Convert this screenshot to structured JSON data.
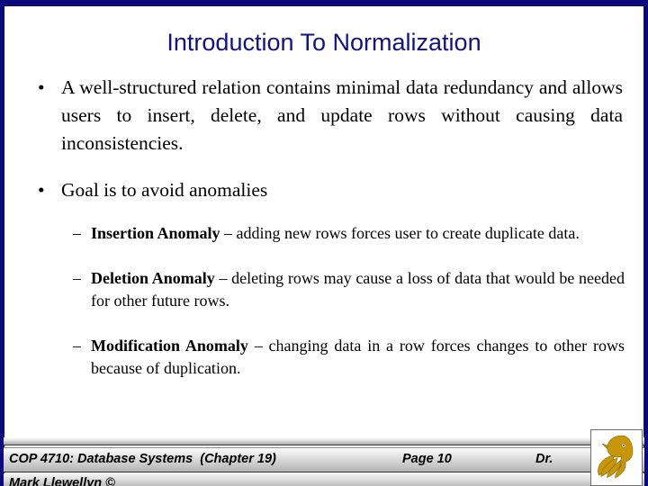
{
  "slide": {
    "title": "Introduction To Normalization",
    "title_color": "#13137d",
    "background_color": "#ffffff",
    "border_color": "#0a0a7a"
  },
  "content": {
    "bullets": [
      {
        "marker": "•",
        "level": 1,
        "text": "A well-structured relation contains minimal data redundancy and allows users to insert, delete, and update rows without causing data inconsistencies."
      },
      {
        "marker": "•",
        "level": 1,
        "text": "Goal is to avoid anomalies"
      }
    ],
    "sub_bullets": [
      {
        "marker": "–",
        "level": 2,
        "lead": "Insertion Anomaly",
        "rest": " – adding new rows forces user to create duplicate data."
      },
      {
        "marker": "–",
        "level": 2,
        "lead": "Deletion Anomaly",
        "rest": " – deleting rows may cause a loss of data that would be needed for other future rows."
      },
      {
        "marker": "–",
        "level": 2,
        "lead": "Modification Anomaly",
        "rest": " – changing data in a row forces changes to other rows because of duplication."
      }
    ]
  },
  "footer": {
    "course": "COP 4710: Database Systems  (Chapter 19)",
    "page": "Page 10",
    "instructor_prefix": "Dr.",
    "author": "Mark Llewellyn ©",
    "logo_name": "ucf-pegasus-logo",
    "logo_color": "#c8960a"
  }
}
